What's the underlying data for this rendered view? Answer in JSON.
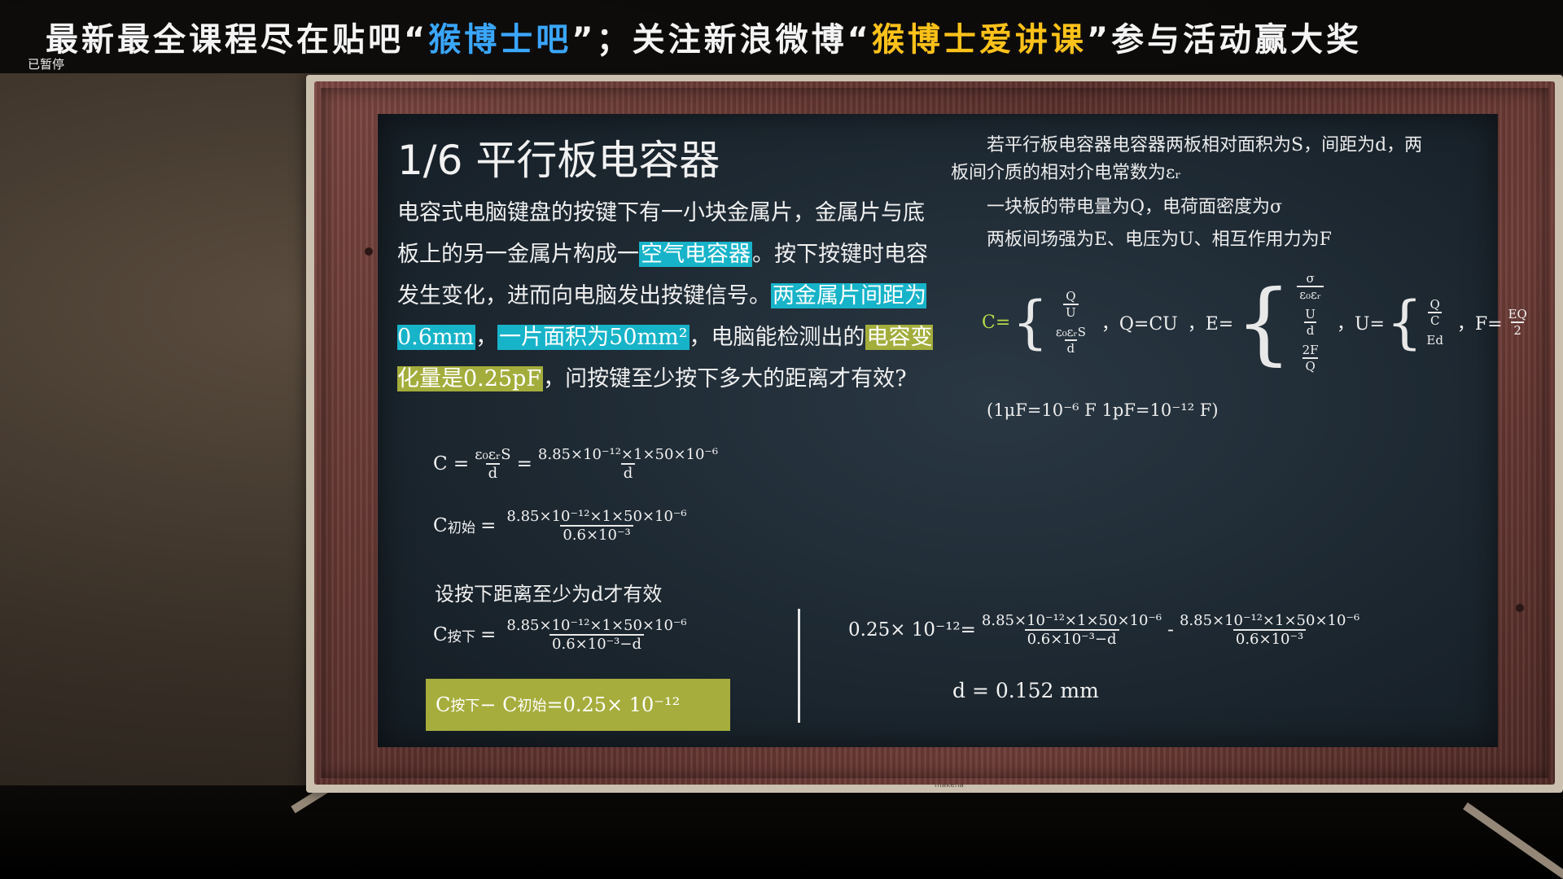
{
  "banner": {
    "part1": "最新最全课程尽在贴吧",
    "q1": "“",
    "blue": "猴博士吧",
    "q2": "”；关注新浪微博",
    "q3": "“",
    "gold": "猴博士爱讲课",
    "part2": "”参与活动赢大奖"
  },
  "player": {
    "status": "已暂停"
  },
  "tv": {
    "brand": "makena"
  },
  "board": {
    "title": "1/6  平行板电容器",
    "problem": {
      "p1": "电容式电脑键盘的按键下有一小块金属片，金属片与底板上的另一金属片构成一",
      "h1": "空气电容器",
      "p2": "。按下按键时电容发生变化，进而向电脑发出按键信号。",
      "h2": "两金属片间距为0.6mm",
      "p3": "，",
      "h3": "一片面积为50mm²",
      "p4": "，电脑能检测出的",
      "h4": "电容变化量是0.25pF",
      "p5": "，问按键至少按下多大的距离才有效?"
    },
    "eq1": {
      "lhs": "C =",
      "f1_num": "ε₀εᵣS",
      "f1_den": "d",
      "eq": "=",
      "f2_num": "8.85×10⁻¹²×1×50×10⁻⁶",
      "f2_den": "d"
    },
    "eq2": {
      "lhs": "C",
      "lhs_sub": "初始",
      "eq": "=",
      "num": "8.85×10⁻¹²×1×50×10⁻⁶",
      "den": "0.6×10⁻³"
    },
    "note": "设按下距离至少为d才有效",
    "eq3": {
      "lhs": "C",
      "lhs_sub": "按下",
      "eq": "=",
      "num": "8.85×10⁻¹²×1×50×10⁻⁶",
      "den": "0.6×10⁻³−d"
    },
    "box": {
      "c1": "C",
      "c1_sub": "按下",
      "minus": " − C",
      "c2_sub": "初始",
      "rhs": " =0.25× 10⁻¹²"
    },
    "eq4": {
      "lhs": "0.25× 10⁻¹²=",
      "num1": "8.85×10⁻¹²×1×50×10⁻⁶",
      "den1": "0.6×10⁻³−d",
      "minus": "-",
      "num2": "8.85×10⁻¹²×1×50×10⁻⁶",
      "den2": "0.6×10⁻³"
    },
    "result": "d = 0.152 mm",
    "right": {
      "line1": "若平行板电容器电容器两板相对面积为S，间距为d，两",
      "line2": "板间介质的相对介电常数为εᵣ",
      "line3": "一块板的带电量为Q，电荷面密度为σ",
      "line4": "两板间场强为E、电压为U、相互作用力为F",
      "c_label": "C=",
      "c_top_num": "Q",
      "c_top_den": "U",
      "c_bot_num": "ε₀εᵣS",
      "c_bot_den": "d",
      "q_label": "，Q=CU",
      "e_label": "，E=",
      "e1_num": "σ",
      "e1_den": "ε₀εᵣ",
      "e2_num": "U",
      "e2_den": "d",
      "e3_num": "2F",
      "e3_den": "Q",
      "u_label": "，U=",
      "u1_num": "Q",
      "u1_den": "C",
      "u2": "Ed",
      "f_label": "，F=",
      "f_num": "EQ",
      "f_den": "2",
      "units": "(1μF=10⁻⁶ F      1pF=10⁻¹² F)"
    }
  }
}
